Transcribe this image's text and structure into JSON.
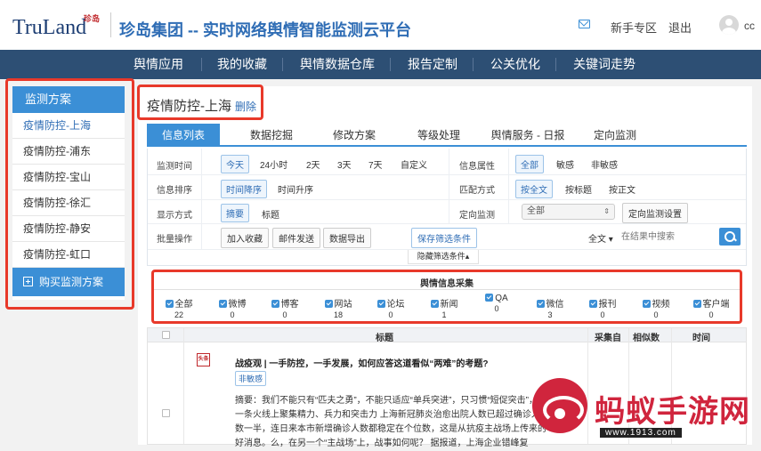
{
  "header": {
    "logo_text": "TruLand",
    "logo_cn": "珍岛",
    "site_title": "珍岛集团 -- 实时网络舆情智能监测云平台",
    "links": [
      "新手专区",
      "退出"
    ],
    "user": "cc"
  },
  "nav": [
    "舆情应用",
    "我的收藏",
    "舆情数据仓库",
    "报告定制",
    "公关优化",
    "关键词走势"
  ],
  "sidebar": {
    "title": "监测方案",
    "items": [
      "疫情防控-上海",
      "疫情防控-浦东",
      "疫情防控-宝山",
      "疫情防控-徐汇",
      "疫情防控-静安",
      "疫情防控-虹口"
    ],
    "buy": "购买监测方案"
  },
  "main": {
    "plan_title": "疫情防控-上海",
    "delete": "删除",
    "tabs": [
      "信息列表",
      "数据挖掘",
      "修改方案",
      "等级处理",
      "舆情服务 - 日报",
      "定向监测"
    ]
  },
  "filters": {
    "time_label": "监测时间",
    "time_opts": [
      "今天",
      "24小时",
      "2天",
      "3天",
      "7天",
      "自定义"
    ],
    "attr_label": "信息属性",
    "attr_opts": [
      "全部",
      "敏感",
      "非敏感"
    ],
    "sort_label": "信息排序",
    "sort_opts": [
      "时间降序",
      "时间升序"
    ],
    "match_label": "匹配方式",
    "match_opts": [
      "按全文",
      "按标题",
      "按正文"
    ],
    "display_label": "显示方式",
    "display_opts": [
      "摘要",
      "标题"
    ],
    "directed_label": "定向监测",
    "directed_value": "全部",
    "directed_btn": "定向监测设置",
    "batch_label": "批量操作",
    "batch_btns": [
      "加入收藏",
      "邮件发送",
      "数据导出"
    ],
    "save_btn": "保存筛选条件",
    "search_scope": "全文 ▾",
    "search_placeholder": "在结果中搜索",
    "hide": "隐藏筛选条件▴"
  },
  "collect": {
    "title": "舆情信息采集",
    "items": [
      {
        "label": "全部",
        "count": "22"
      },
      {
        "label": "微博",
        "count": "0"
      },
      {
        "label": "博客",
        "count": "0"
      },
      {
        "label": "网站",
        "count": "18"
      },
      {
        "label": "论坛",
        "count": "0"
      },
      {
        "label": "新闻",
        "count": "1"
      },
      {
        "label": "QA",
        "count": "0"
      },
      {
        "label": "微信",
        "count": "3"
      },
      {
        "label": "报刊",
        "count": "0"
      },
      {
        "label": "视频",
        "count": "0"
      },
      {
        "label": "客户端",
        "count": "0"
      }
    ]
  },
  "table": {
    "headers": [
      "标题",
      "采集自",
      "相似数",
      "时间"
    ],
    "row": {
      "source": "头条",
      "title": "战疫观 | 一手防控，一手发展，如何应答这道看似“两难”的考题?",
      "badge": "非敏感",
      "summary": "摘要：我们不能只有“匹夫之勇”，不能只适应“单兵突进”，只习惯“短促突击”，在一条火线上聚集精力、兵力和突击力 上海新冠肺炎治愈出院人数已超过确诊人数一半，连日来本市新增确诊人数都稳定在个位数，这是从抗疫主战场上传来的好消息。么，在另一个“主战场”上，战事如何呢？ 据报道，上海企业错峰复"
    }
  },
  "watermark": {
    "text": "蚂蚁手游网",
    "url": "www.1913.com"
  }
}
